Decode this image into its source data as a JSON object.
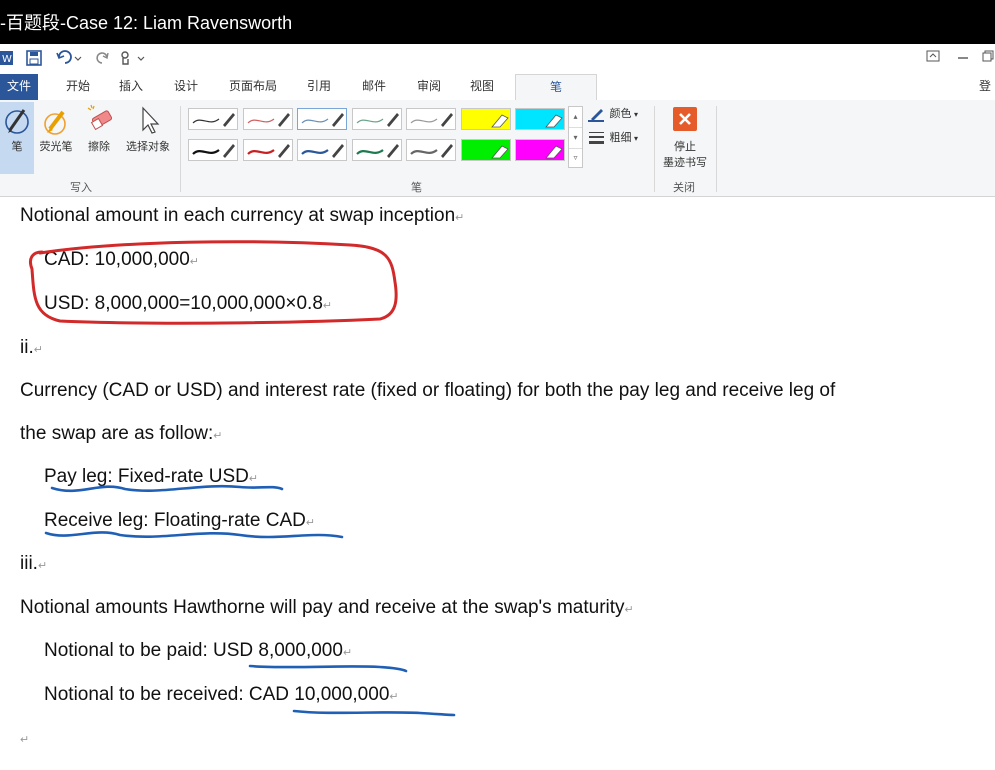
{
  "window": {
    "title": "-百题段-Case 12: Liam Ravensworth",
    "login_label": "登"
  },
  "tabs": [
    {
      "label": "文件"
    },
    {
      "label": "开始"
    },
    {
      "label": "插入"
    },
    {
      "label": "设计"
    },
    {
      "label": "页面布局"
    },
    {
      "label": "引用"
    },
    {
      "label": "邮件"
    },
    {
      "label": "审阅"
    },
    {
      "label": "视图"
    },
    {
      "label": "笔"
    }
  ],
  "ribbon": {
    "write_group": {
      "label": "写入",
      "pen": "笔",
      "highlighter": "荧光笔",
      "eraser": "擦除",
      "select": "选择对象"
    },
    "pens_group": {
      "label": "笔",
      "color_label": "颜色",
      "thickness_label": "粗细"
    },
    "close_group": {
      "label": "关闭",
      "stop_label_1": "停止",
      "stop_label_2": "墨迹书写"
    }
  },
  "colors": {
    "ribbon_accent": "#2b579a",
    "ink_red": "#d22a2a",
    "ink_blue": "#1f5fb5",
    "highlight_yellow": "#ffff00",
    "highlight_cyan": "#00e5ff",
    "highlight_green": "#00ee00",
    "highlight_magenta": "#ff00ff"
  },
  "doc": {
    "l1": "Notional amount in each currency at swap inception",
    "l2": "CAD: 10,000,000",
    "l3": "USD: 8,000,000=10,000,000×0.8",
    "l4": "ii.",
    "l5": "Currency (CAD or USD) and interest rate (fixed or floating) for both the pay leg and receive leg of",
    "l6": "the swap are as follow:",
    "l7": "Pay leg: Fixed-rate USD",
    "l8": "Receive leg: Floating-rate CAD",
    "l9": "iii.",
    "l10": "Notional amounts Hawthorne will pay and receive at the swap's maturity",
    "l11": "Notional to be paid: USD 8,000,000",
    "l12": "Notional to be received: CAD 10,000,000",
    "para_mark": "↵"
  }
}
